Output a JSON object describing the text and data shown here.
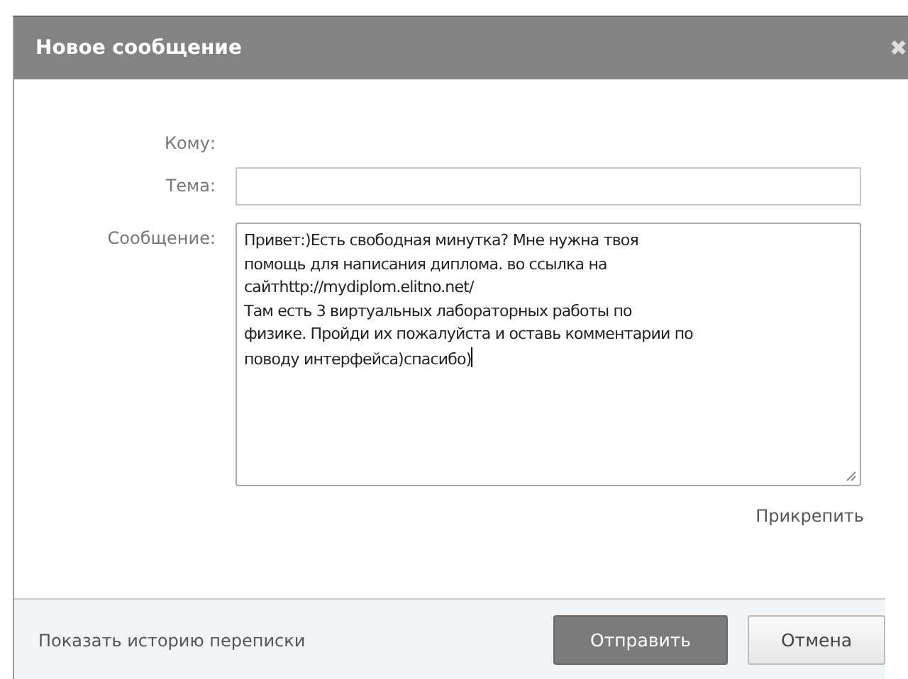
{
  "window": {
    "title": "Новое сообщение",
    "close": "✖"
  },
  "fields": [
    {
      "label": "Кому:",
      "kind": "static"
    },
    {
      "label": "Тема:",
      "kind": "input"
    },
    {
      "label": "Сообщение:",
      "kind": "textarea",
      "value": "Привет:)Есть свободная минутка? Мне нужна твоя\nпомощь для написания диплома. во ссылка на\nсайтhttp://mydiplom.elitno.net/\nТам есть 3 виртуальных лабораторных работы по\nфизике. Пройди их пожалуйста и оставь комментарии по\nповоду интерфейса)спасибо)"
    }
  ],
  "attach": "Прикрепить",
  "footer": {
    "history_link": "Показать историю переписки",
    "buttons": [
      {
        "label": "Отправить",
        "kind": "primary"
      },
      {
        "label": "Отмена",
        "kind": "secondary"
      }
    ]
  }
}
